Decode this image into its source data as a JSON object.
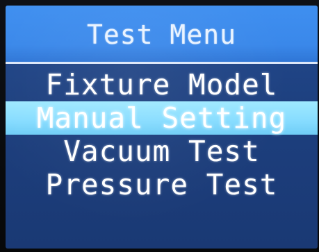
{
  "screen": {
    "title": "Test Menu",
    "menu": {
      "items": [
        {
          "label": "Fixture Model",
          "selected": false
        },
        {
          "label": "Manual Setting",
          "selected": true
        },
        {
          "label": "Vacuum Test",
          "selected": false
        },
        {
          "label": "Pressure Test",
          "selected": false
        }
      ]
    }
  },
  "colors": {
    "title_bar": "#3f8ff0",
    "screen_bg": "#1d3f7e",
    "selected_bg": "#86dcff",
    "text": "#ffffff"
  }
}
